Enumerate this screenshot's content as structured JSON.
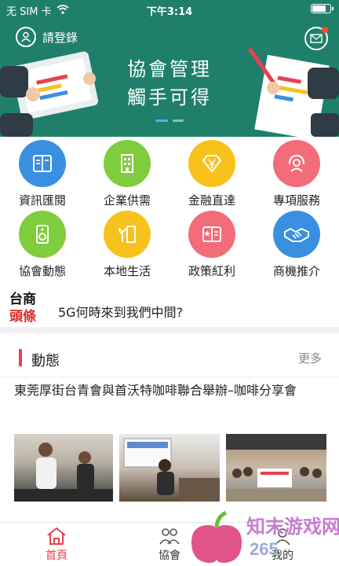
{
  "status_bar": {
    "carrier": "无 SIM 卡",
    "time": "下午3:14"
  },
  "banner": {
    "login_label": "請登錄",
    "title_line1": "協會管理",
    "title_line2": "觸手可得"
  },
  "grid": [
    {
      "label": "資訊匯閱",
      "color": "#3a8fe0",
      "icon": "book-icon"
    },
    {
      "label": "企業供需",
      "color": "#7fcc3c",
      "icon": "building-icon"
    },
    {
      "label": "金融直達",
      "color": "#f8c21c",
      "icon": "yen-diamond-icon"
    },
    {
      "label": "專項服務",
      "color": "#f26c79",
      "icon": "headset-icon"
    },
    {
      "label": "協會動態",
      "color": "#7fcc3c",
      "icon": "speaker-icon"
    },
    {
      "label": "本地生活",
      "color": "#f8c21c",
      "icon": "plant-door-icon"
    },
    {
      "label": "政策紅利",
      "color": "#f26c79",
      "icon": "star-book-icon"
    },
    {
      "label": "商機推介",
      "color": "#3a8fe0",
      "icon": "handshake-icon"
    }
  ],
  "headline": {
    "logo_line1": "台商",
    "logo_line2": "頭條",
    "text": "5G何時來到我們中間?"
  },
  "section": {
    "title": "動態",
    "more": "更多"
  },
  "article": {
    "title": "東莞厚街台青會與首沃特咖啡聯合舉辦–咖啡分享會"
  },
  "tabs": [
    {
      "label": "首頁",
      "icon": "home-icon",
      "active": true
    },
    {
      "label": "協會",
      "icon": "people-icon",
      "active": false
    },
    {
      "label": "我的",
      "icon": "user-icon",
      "active": false
    }
  ],
  "colors": {
    "brand_green": "#1f7f6a",
    "accent_red": "#e8424e"
  }
}
